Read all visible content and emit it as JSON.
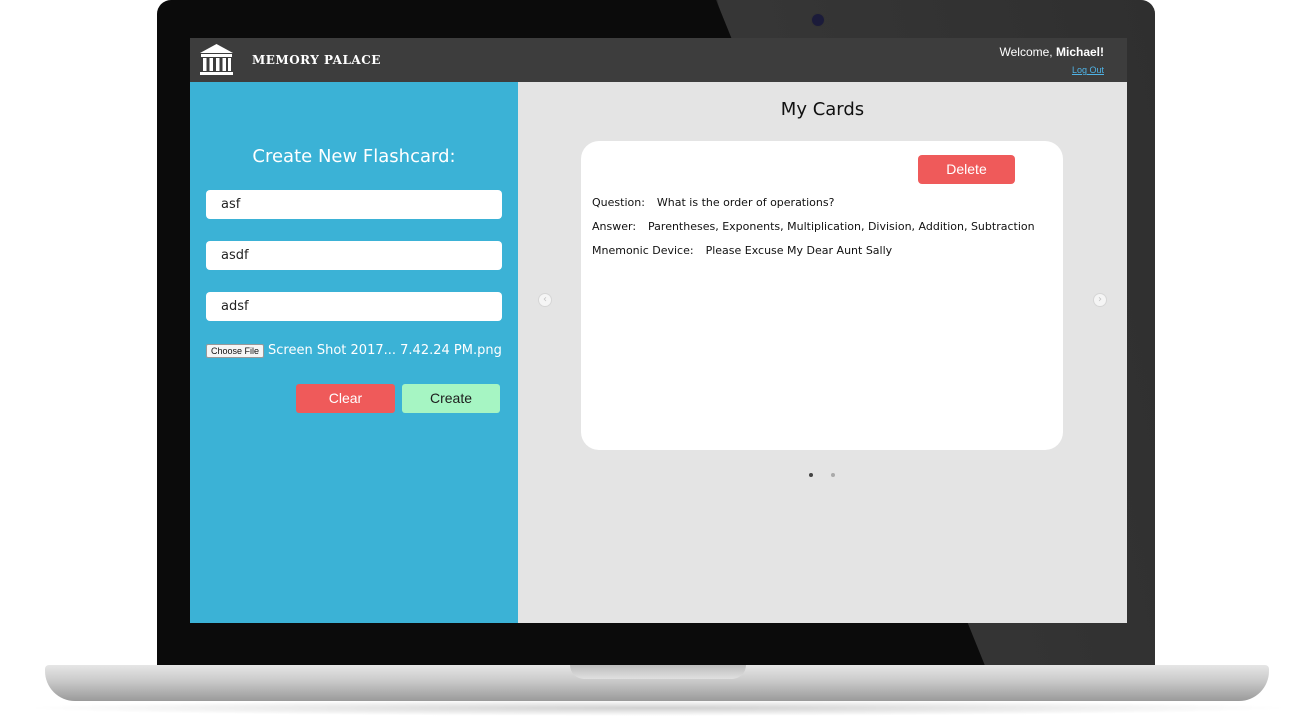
{
  "header": {
    "brand": "MEMORY PALACE",
    "welcome_prefix": "Welcome, ",
    "username": "Michael!",
    "logout_label": "Log Out"
  },
  "create_panel": {
    "title": "Create New Flashcard:",
    "question_value": "asf",
    "answer_value": "asdf",
    "mnemonic_value": "adsf",
    "choose_file_label": "Choose File",
    "file_name": "Screen Shot 2017... 7.42.24 PM.png",
    "clear_label": "Clear",
    "create_label": "Create"
  },
  "cards_panel": {
    "title": "My Cards",
    "delete_label": "Delete",
    "card": {
      "question_label": "Question:",
      "question": "What is the order of operations?",
      "answer_label": "Answer:",
      "answer": "Parentheses, Exponents, Multiplication, Division, Addition, Subtraction",
      "mnemonic_label": "Mnemonic Device:",
      "mnemonic": "Please Excuse My Dear Aunt Sally"
    },
    "carousel": {
      "prev_icon": "chevron-left-icon",
      "next_icon": "chevron-right-icon",
      "page_count": 2,
      "active_page": 1
    }
  },
  "colors": {
    "topbar": "#3d3d3d",
    "left_panel": "#3bb2d6",
    "right_panel": "#e4e4e4",
    "clear_button": "#ef5a5a",
    "create_button": "#a6f5c3",
    "delete_button": "#ef5a5a",
    "logout_link": "#4fb3e6"
  }
}
